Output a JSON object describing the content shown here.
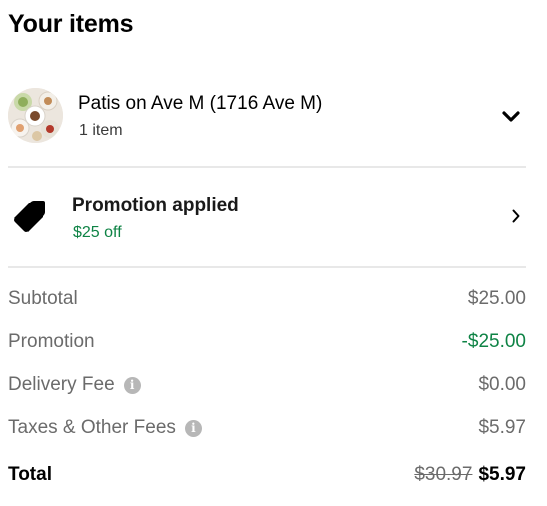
{
  "header": {
    "title": "Your items"
  },
  "store": {
    "name": "Patis on Ave M (1716 Ave M)",
    "item_count": "1 item",
    "avatar_icon": "store-thumbnail",
    "expand_icon": "chevron-down-icon"
  },
  "promotion": {
    "title": "Promotion applied",
    "detail": "$25 off",
    "icon": "tag-icon",
    "arrow_icon": "chevron-right-icon",
    "accent_color": "#0e8345"
  },
  "summary": {
    "subtotal": {
      "label": "Subtotal",
      "value": "$25.00"
    },
    "promotion": {
      "label": "Promotion",
      "value": "-$25.00"
    },
    "delivery_fee": {
      "label": "Delivery Fee",
      "value": "$0.00",
      "info_icon": "info-icon"
    },
    "taxes": {
      "label": "Taxes & Other Fees",
      "value": "$5.97",
      "info_icon": "info-icon"
    },
    "total": {
      "label": "Total",
      "original": "$30.97",
      "value": "$5.97"
    }
  }
}
